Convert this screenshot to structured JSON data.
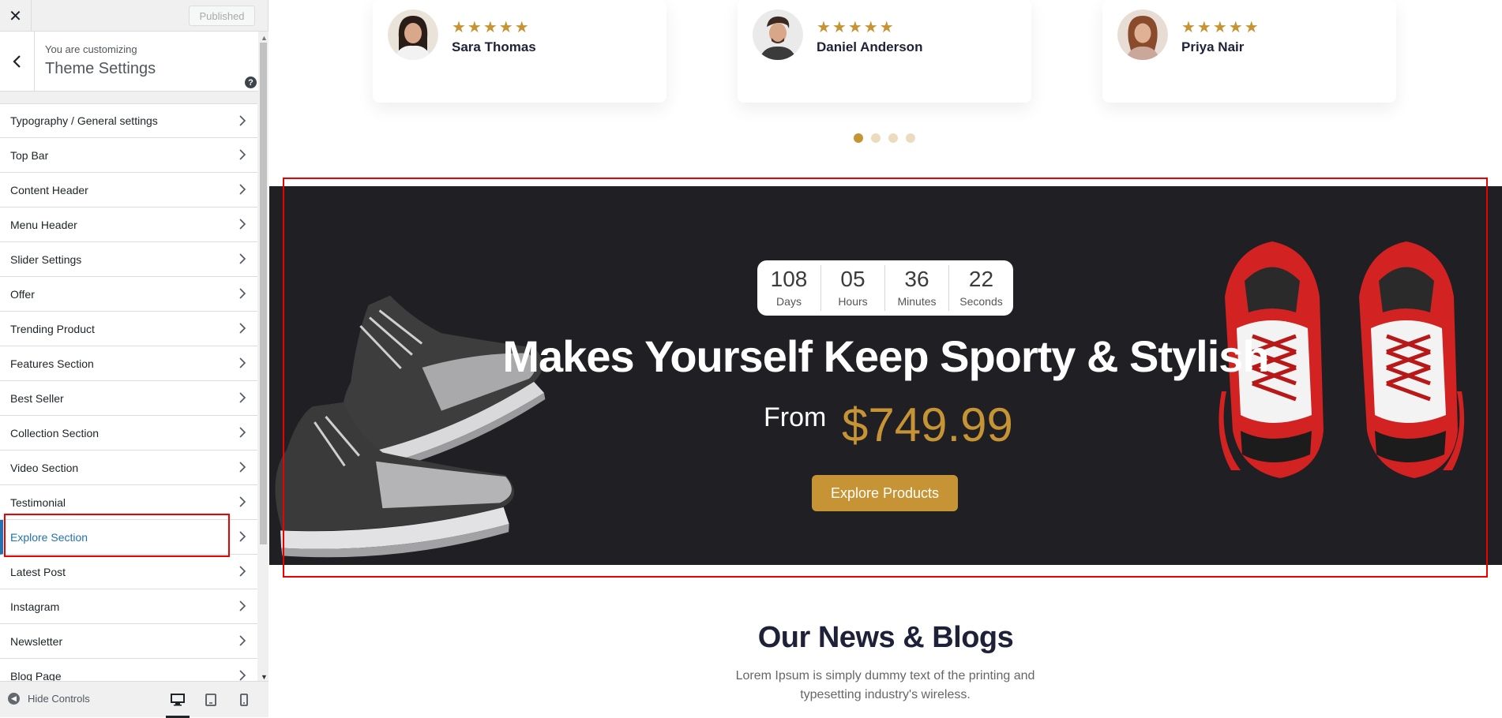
{
  "sidebar": {
    "close_icon": "close-icon",
    "publish_label": "Published",
    "header": {
      "subtitle": "You are customizing",
      "title": "Theme Settings",
      "help": "?"
    },
    "items": [
      {
        "label": "Typography / General settings"
      },
      {
        "label": "Top Bar"
      },
      {
        "label": "Content Header"
      },
      {
        "label": "Menu Header"
      },
      {
        "label": "Slider Settings"
      },
      {
        "label": "Offer"
      },
      {
        "label": "Trending Product"
      },
      {
        "label": "Features Section"
      },
      {
        "label": "Best Seller"
      },
      {
        "label": "Collection Section"
      },
      {
        "label": "Video Section"
      },
      {
        "label": "Testimonial"
      },
      {
        "label": "Explore Section",
        "active": true
      },
      {
        "label": "Latest Post"
      },
      {
        "label": "Instagram"
      },
      {
        "label": "Newsletter"
      },
      {
        "label": "Blog Page"
      }
    ],
    "footer": {
      "hide_controls": "Hide Controls",
      "devices": [
        "desktop-icon",
        "tablet-icon",
        "mobile-icon"
      ]
    }
  },
  "preview": {
    "testimonials": [
      {
        "name": "Sara Thomas",
        "stars": "★★★★★",
        "rating": 5
      },
      {
        "name": "Daniel Anderson",
        "stars": "★★★★★",
        "rating": 5
      },
      {
        "name": "Priya Nair",
        "stars": "★★★★★",
        "rating": 5
      }
    ],
    "carousel": {
      "total": 4,
      "active_index": 0
    },
    "explore": {
      "countdown": [
        {
          "value": "108",
          "label": "Days"
        },
        {
          "value": "05",
          "label": "Hours"
        },
        {
          "value": "36",
          "label": "Minutes"
        },
        {
          "value": "22",
          "label": "Seconds"
        }
      ],
      "title": "Makes Yourself Keep Sporty & Stylish",
      "from_label": "From",
      "price": "$749.99",
      "button_label": "Explore Products"
    },
    "news": {
      "title": "Our News & Blogs",
      "subtitle": "Lorem Ipsum is simply dummy text of the printing and typesetting industry's wireless."
    }
  },
  "colors": {
    "accent": "#c69434",
    "dark_banner": "#1f1f24",
    "wp_blue": "#2271b1",
    "highlight_red": "#ee0000"
  }
}
